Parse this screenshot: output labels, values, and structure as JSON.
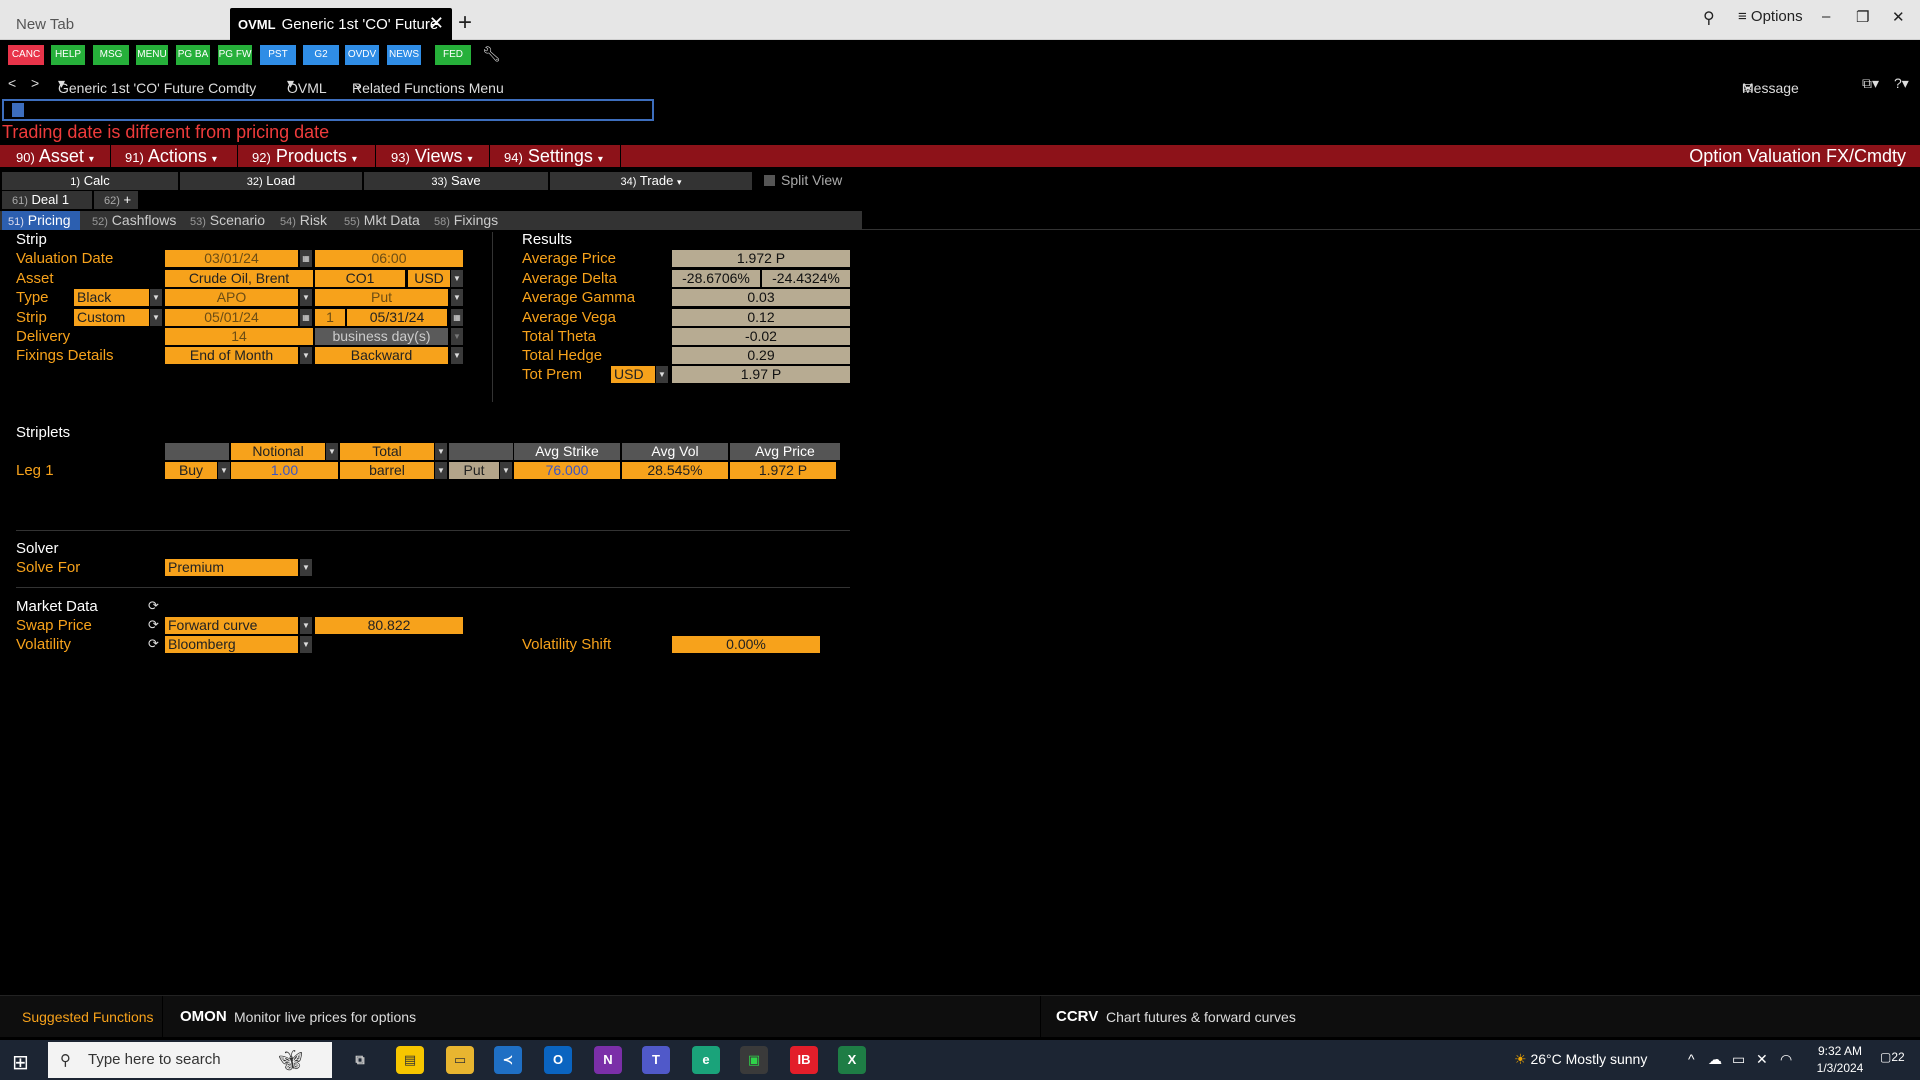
{
  "browser": {
    "tabs": [
      {
        "title": "New Tab"
      },
      {
        "brand": "OVML",
        "title": "Generic 1st 'CO' Future"
      }
    ],
    "new_tab_icon": "plus-icon",
    "options_label": "Options"
  },
  "toolbar": {
    "buttons": [
      {
        "label": "CANC",
        "color": "#e8344a"
      },
      {
        "label": "HELP",
        "color": "#26b03a"
      },
      {
        "label": "MSG",
        "color": "#26b03a"
      },
      {
        "label": "MENU",
        "color": "#26b03a"
      },
      {
        "label": "PG BA",
        "color": "#26b03a"
      },
      {
        "label": "PG FW",
        "color": "#26b03a"
      },
      {
        "label": "PST",
        "color": "#2f8de6"
      },
      {
        "label": "G2",
        "color": "#2f8de6"
      },
      {
        "label": "OVDV",
        "color": "#2f8de6"
      },
      {
        "label": "NEWS",
        "color": "#2f8de6"
      },
      {
        "label": "FED",
        "color": "#26b03a"
      }
    ]
  },
  "nav": {
    "security": "Generic 1st 'CO' Future Comdty",
    "function": "OVML",
    "related": "Related Functions Menu",
    "message": "Message"
  },
  "warning": "Trading date is different from pricing date",
  "menu": {
    "items": [
      {
        "num": "90)",
        "label": "Asset"
      },
      {
        "num": "91)",
        "label": "Actions"
      },
      {
        "num": "92)",
        "label": "Products"
      },
      {
        "num": "93)",
        "label": "Views"
      },
      {
        "num": "94)",
        "label": "Settings"
      }
    ],
    "app_title": "Option Valuation FX/Cmdty"
  },
  "actions": [
    {
      "num": "1)",
      "label": "Calc"
    },
    {
      "num": "32)",
      "label": "Load"
    },
    {
      "num": "33)",
      "label": "Save"
    },
    {
      "num": "34)",
      "label": "Trade"
    }
  ],
  "split_view": "Split View",
  "deals": [
    {
      "num": "61)",
      "label": "Deal 1"
    },
    {
      "num": "62)",
      "label": "+"
    }
  ],
  "subtabs": [
    {
      "num": "51)",
      "label": "Pricing"
    },
    {
      "num": "52)",
      "label": "Cashflows"
    },
    {
      "num": "53)",
      "label": "Scenario"
    },
    {
      "num": "54)",
      "label": "Risk"
    },
    {
      "num": "55)",
      "label": "Mkt Data"
    },
    {
      "num": "58)",
      "label": "Fixings"
    }
  ],
  "strip": {
    "header": "Strip",
    "valuation_date_label": "Valuation Date",
    "valuation_date": "03/01/24",
    "valuation_time": "06:00",
    "asset_label": "Asset",
    "asset": "Crude Oil, Brent",
    "asset_code": "CO1",
    "currency": "USD",
    "type_label": "Type",
    "model": "Black",
    "option_style": "APO",
    "option_type": "Put",
    "strip_label": "Strip",
    "strip_mode": "Custom",
    "start_date": "05/01/24",
    "count": "1",
    "end_date": "05/31/24",
    "delivery_label": "Delivery",
    "delivery": "14",
    "delivery_unit": "business day(s)",
    "fixings_label": "Fixings Details",
    "fixings": "End of Month",
    "fixings_direction": "Backward"
  },
  "results": {
    "header": "Results",
    "average_price_label": "Average Price",
    "average_price": "1.972 P",
    "average_delta_label": "Average Delta",
    "average_delta_1": "-28.6706%",
    "average_delta_2": "-24.4324%",
    "average_gamma_label": "Average Gamma",
    "average_gamma": "0.03",
    "average_vega_label": "Average Vega",
    "average_vega": "0.12",
    "total_theta_label": "Total Theta",
    "total_theta": "-0.02",
    "total_hedge_label": "Total Hedge",
    "total_hedge": "0.29",
    "tot_prem_label": "Tot Prem",
    "tot_prem_ccy": "USD",
    "tot_prem": "1.97 P"
  },
  "striplets": {
    "header": "Striplets",
    "columns": [
      "Notional",
      "Total",
      "Avg Strike",
      "Avg Vol",
      "Avg Price"
    ],
    "leg_label": "Leg 1",
    "direction": "Buy",
    "notional": "1.00",
    "unit": "barrel",
    "type": "Put",
    "avg_strike": "76.000",
    "avg_vol": "28.545%",
    "avg_price": "1.972 P"
  },
  "solver": {
    "header": "Solver",
    "solve_for_label": "Solve For",
    "solve_for": "Premium"
  },
  "market_data": {
    "header": "Market Data",
    "swap_price_label": "Swap Price",
    "swap_source": "Forward curve",
    "swap_price": "80.822",
    "volatility_label": "Volatility",
    "vol_source": "Bloomberg",
    "vol_shift_label": "Volatility Shift",
    "vol_shift": "0.00%"
  },
  "suggested": {
    "title": "Suggested Functions",
    "items": [
      {
        "code": "OMON",
        "desc": "Monitor live prices for options"
      },
      {
        "code": "CCRV",
        "desc": "Chart futures & forward curves"
      }
    ]
  },
  "taskbar": {
    "search_placeholder": "Type here to search",
    "weather": "26°C  Mostly sunny",
    "time": "9:32 AM",
    "date": "1/3/2024",
    "notifications": "22"
  }
}
